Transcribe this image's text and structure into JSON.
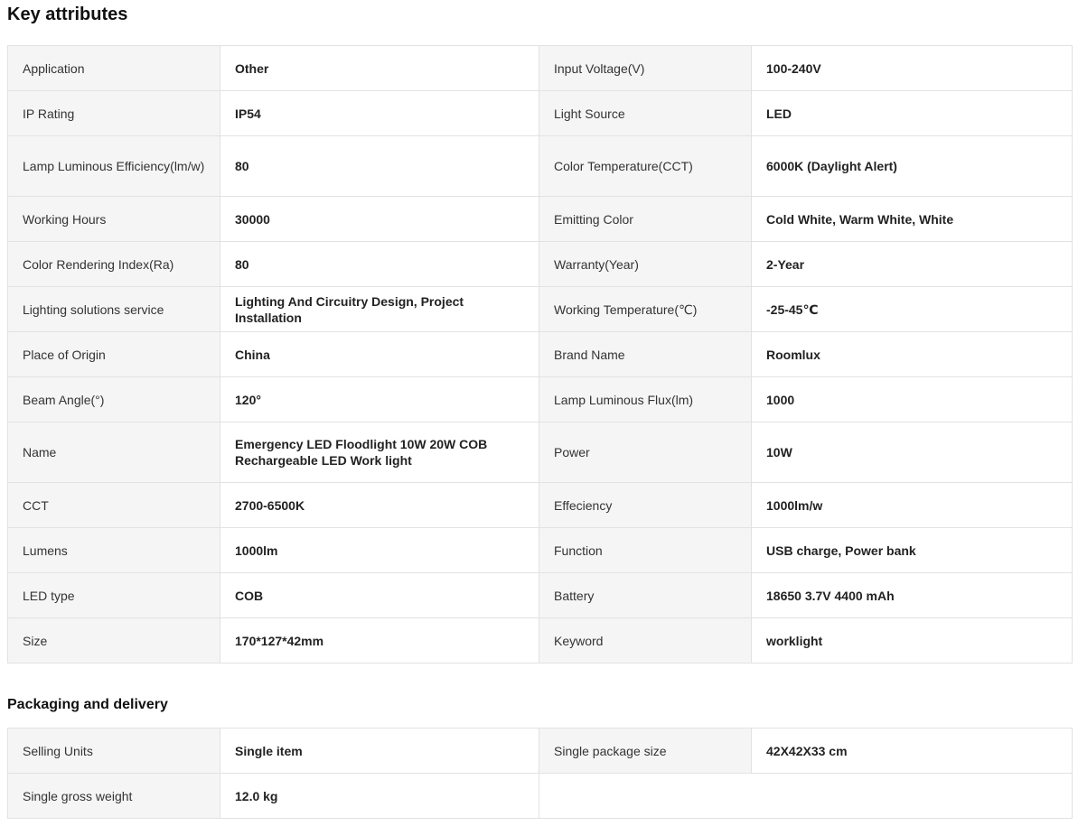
{
  "key_attributes": {
    "title": "Key attributes",
    "rows": [
      {
        "label1": "Application",
        "value1": "Other",
        "label2": "Input Voltage(V)",
        "value2": "100-240V"
      },
      {
        "label1": "IP Rating",
        "value1": "IP54",
        "label2": "Light Source",
        "value2": "LED"
      },
      {
        "label1": "Lamp Luminous Efficiency(lm/w)",
        "value1": "80",
        "label2": "Color Temperature(CCT)",
        "value2": "6000K (Daylight Alert)"
      },
      {
        "label1": "Working Hours",
        "value1": "30000",
        "label2": "Emitting Color",
        "value2": "Cold White, Warm White, White"
      },
      {
        "label1": "Color Rendering Index(Ra)",
        "value1": "80",
        "label2": "Warranty(Year)",
        "value2": "2-Year"
      },
      {
        "label1": "Lighting solutions service",
        "value1": "Lighting And Circuitry Design, Project Installation",
        "label2": "Working Temperature(℃)",
        "value2": "-25-45℃"
      },
      {
        "label1": "Place of Origin",
        "value1": "China",
        "label2": "Brand Name",
        "value2": "Roomlux"
      },
      {
        "label1": "Beam Angle(°)",
        "value1": "120°",
        "label2": "Lamp Luminous Flux(lm)",
        "value2": "1000"
      },
      {
        "label1": "Name",
        "value1": "Emergency LED Floodlight 10W 20W COB Rechargeable LED Work light",
        "label2": "Power",
        "value2": "10W"
      },
      {
        "label1": "CCT",
        "value1": "2700-6500K",
        "label2": "Effeciency",
        "value2": "1000lm/w"
      },
      {
        "label1": "Lumens",
        "value1": "1000lm",
        "label2": "Function",
        "value2": "USB charge, Power bank"
      },
      {
        "label1": "LED type",
        "value1": "COB",
        "label2": "Battery",
        "value2": "18650 3.7V 4400 mAh"
      },
      {
        "label1": "Size",
        "value1": "170*127*42mm",
        "label2": "Keyword",
        "value2": "worklight"
      }
    ]
  },
  "packaging": {
    "title": "Packaging and delivery",
    "rows": [
      {
        "label1": "Selling Units",
        "value1": "Single item",
        "label2": "Single package size",
        "value2": "42X42X33 cm"
      },
      {
        "label1": "Single gross weight",
        "value1": "12.0 kg"
      }
    ]
  }
}
